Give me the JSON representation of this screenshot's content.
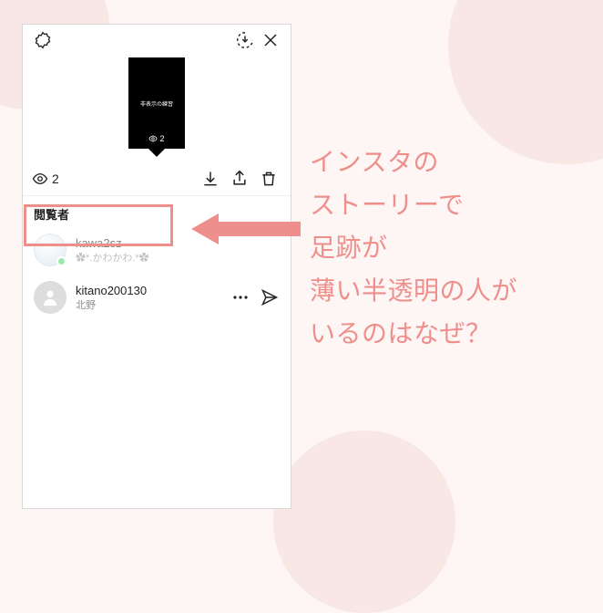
{
  "story": {
    "thumb_label": "非表示の練習",
    "thumb_view_count": "2"
  },
  "viewers_bar": {
    "count": "2"
  },
  "section": {
    "header": "閲覧者"
  },
  "viewers": {
    "0": {
      "username": "kawa2sz",
      "display_name": "✿*.かわかわ.*✿"
    },
    "1": {
      "username": "kitano200130",
      "display_name": "北野"
    }
  },
  "annotation": {
    "line1": "インスタの",
    "line2": "ストーリーで",
    "line3": "足跡が",
    "line4": "薄い半透明の人が",
    "line5": "いるのはなぜ？"
  }
}
